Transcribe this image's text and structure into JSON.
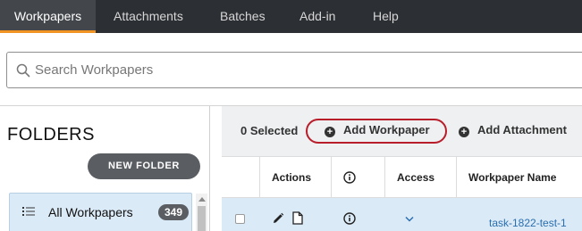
{
  "nav": {
    "tabs": [
      {
        "label": "Workpapers",
        "active": true
      },
      {
        "label": "Attachments",
        "active": false
      },
      {
        "label": "Batches",
        "active": false
      },
      {
        "label": "Add-in",
        "active": false
      },
      {
        "label": "Help",
        "active": false
      }
    ],
    "accent_color": "#f29423"
  },
  "search": {
    "placeholder": "Search Workpapers",
    "value": "",
    "icon": "search-icon"
  },
  "folders": {
    "title": "FOLDERS",
    "new_folder_label": "NEW FOLDER",
    "items": [
      {
        "label": "All Workpapers",
        "count": "349",
        "selected": true,
        "icon": "list-icon"
      }
    ]
  },
  "toolbar": {
    "selected_label": "0 Selected",
    "add_workpaper_label": "Add Workpaper",
    "add_attachment_label": "Add Attachment",
    "highlight_color": "#b81d2a"
  },
  "table": {
    "columns": [
      "",
      "Actions",
      "info-icon",
      "Access",
      "Workpaper Name"
    ],
    "rows": [
      {
        "checked": false,
        "actions": [
          "pencil-icon",
          "document-icon"
        ],
        "info": "info-icon",
        "access": "chevron-down-icon",
        "name": "task-1822-test-1"
      }
    ],
    "selected_row_color": "#dbeaf7",
    "link_color": "#2a6fb0"
  }
}
